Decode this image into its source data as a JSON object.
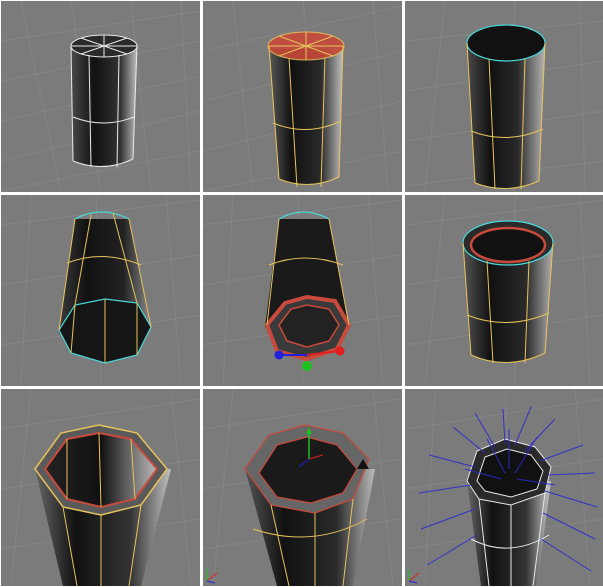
{
  "panels": [
    {
      "id": "step-1",
      "selection": "none"
    },
    {
      "id": "step-2",
      "selection": "top-polygon"
    },
    {
      "id": "step-3",
      "selection": "top-border"
    },
    {
      "id": "step-4",
      "selection": "bottom-border"
    },
    {
      "id": "step-5",
      "selection": "bottom-border-extruded"
    },
    {
      "id": "step-6",
      "selection": "top-inset"
    },
    {
      "id": "step-7",
      "selection": "top-inset-closeup"
    },
    {
      "id": "step-8",
      "selection": "top-inset-move"
    },
    {
      "id": "step-9",
      "selection": "normals-display"
    }
  ],
  "colors": {
    "viewport_bg": "#7b7b7b",
    "grid_line": "#8c8c8c",
    "mesh_white": "#e8e8e8",
    "mesh_yellow": "#e6c35a",
    "selection_red": "#c84a3a",
    "border_cyan": "#48d8d8",
    "gizmo_green": "#20c020",
    "gizmo_red": "#e02020",
    "gizmo_blue": "#2020e0",
    "normals_blue": "#2a2ad0"
  }
}
